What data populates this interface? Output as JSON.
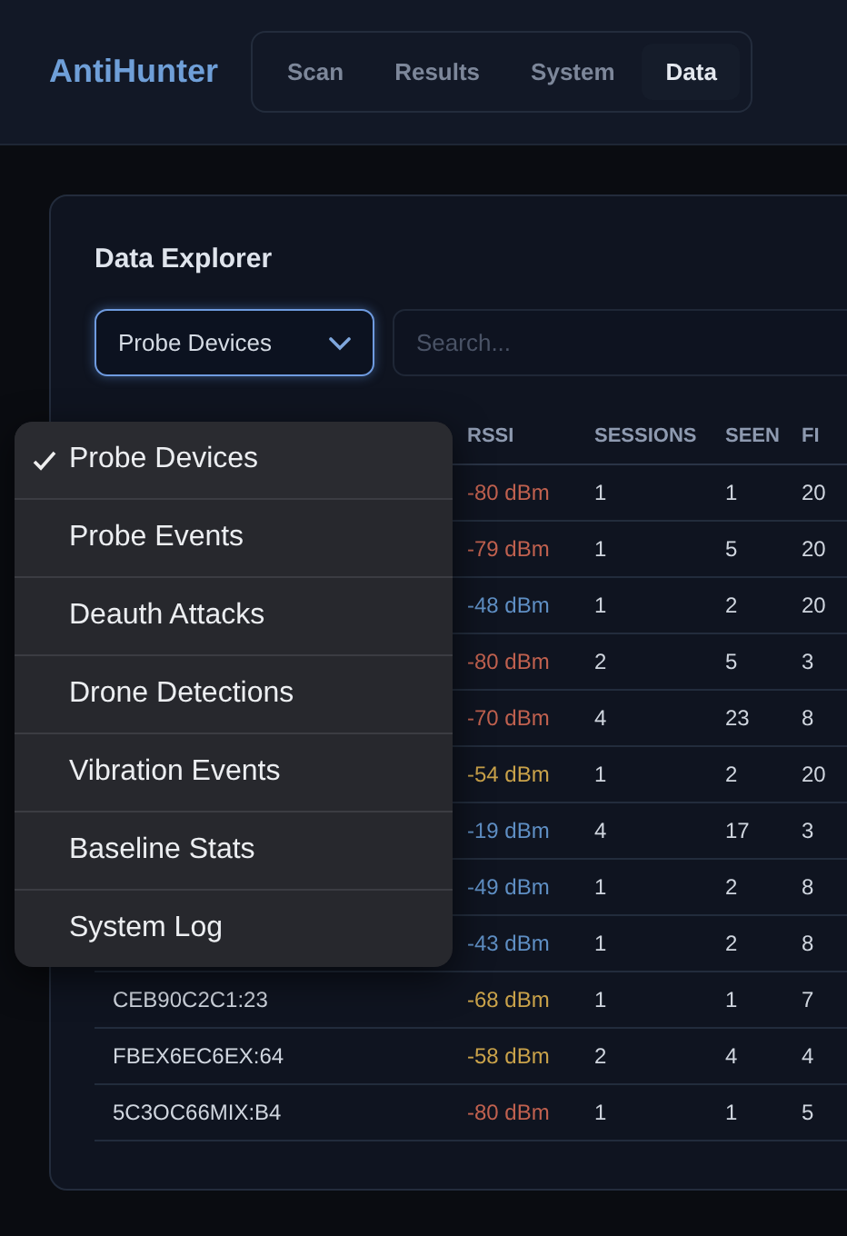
{
  "header": {
    "logo": "AntiHunter",
    "tabs": [
      {
        "label": "Scan",
        "selected": false
      },
      {
        "label": "Results",
        "selected": false
      },
      {
        "label": "System",
        "selected": false
      },
      {
        "label": "Data",
        "selected": true
      }
    ]
  },
  "explorer": {
    "title": "Data Explorer",
    "select": {
      "value": "Probe Devices",
      "expanded": true,
      "options": [
        {
          "label": "Probe Devices",
          "selected": true
        },
        {
          "label": "Probe Events",
          "selected": false
        },
        {
          "label": "Deauth Attacks",
          "selected": false
        },
        {
          "label": "Drone Detections",
          "selected": false
        },
        {
          "label": "Vibration Events",
          "selected": false
        },
        {
          "label": "Baseline Stats",
          "selected": false
        },
        {
          "label": "System Log",
          "selected": false
        }
      ]
    },
    "search": {
      "placeholder": "Search..."
    },
    "table": {
      "columns": [
        "RSSI",
        "SESSIONS",
        "SEEN",
        "FI"
      ],
      "rows": [
        {
          "rssi": "-80 dBm",
          "color": "#c0614f",
          "sessions": "1",
          "seen": "1",
          "column_5": "20"
        },
        {
          "rssi": "-79 dBm",
          "color": "#c0614f",
          "sessions": "1",
          "seen": "5",
          "column_5": "20"
        },
        {
          "rssi": "-48 dBm",
          "color": "#5f8fc4",
          "sessions": "1",
          "seen": "2",
          "column_5": "20"
        },
        {
          "rssi": "-80 dBm",
          "color": "#c0614f",
          "sessions": "2",
          "seen": "5",
          "column_5": "3"
        },
        {
          "rssi": "-70 dBm",
          "color": "#c0614f",
          "sessions": "4",
          "seen": "23",
          "column_5": "8"
        },
        {
          "rssi": "-54 dBm",
          "color": "#c9a24a",
          "sessions": "1",
          "seen": "2",
          "column_5": "20"
        },
        {
          "rssi": "-19 dBm",
          "color": "#5f8fc4",
          "sessions": "4",
          "seen": "17",
          "column_5": "3"
        },
        {
          "rssi": "-49 dBm",
          "color": "#5f8fc4",
          "sessions": "1",
          "seen": "2",
          "column_5": "8"
        },
        {
          "rssi": "-43 dBm",
          "color": "#5f8fc4",
          "sessions": "1",
          "seen": "2",
          "column_5": "8"
        },
        {
          "mac": "CEB90C2C1:23",
          "rssi": "-68 dBm",
          "color": "#c9a24a",
          "sessions": "1",
          "seen": "1",
          "column_5": "7"
        },
        {
          "mac": "FBEX6EC6EX:64",
          "rssi": "-58 dBm",
          "color": "#c9a24a",
          "sessions": "2",
          "seen": "4",
          "column_5": "4"
        },
        {
          "mac": "5C3OC66MIX:B4",
          "rssi": "-80 dBm",
          "color": "#c0614f",
          "sessions": "1",
          "seen": "1",
          "column_5": "5"
        }
      ]
    }
  }
}
